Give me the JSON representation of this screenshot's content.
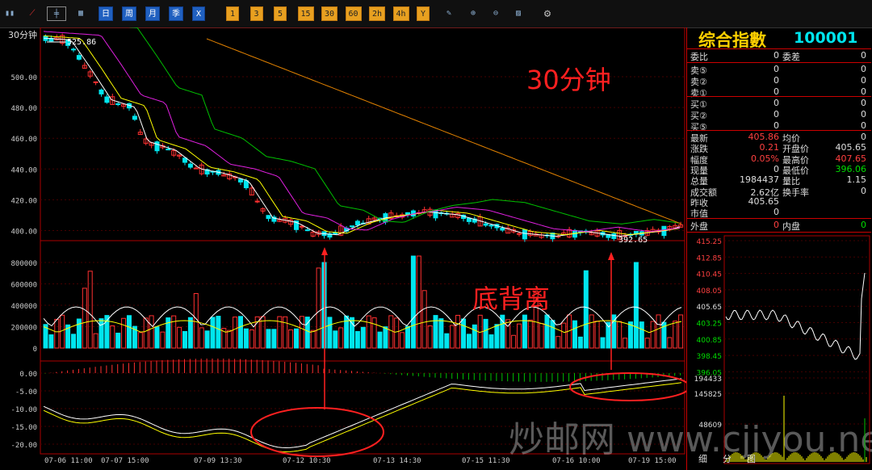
{
  "toolbar": {
    "period_buttons": [
      "日",
      "周",
      "月",
      "季",
      "X"
    ],
    "minute_buttons": [
      "1",
      "3",
      "5",
      "15",
      "30",
      "60",
      "2h",
      "4h",
      "Y"
    ]
  },
  "chart": {
    "period_label": "30分钟",
    "watermark_period": "30分钟",
    "annotation_divergence": "底背离",
    "high_label": "525.86",
    "low_label": "392.65",
    "price_ticks": [
      "500.00",
      "480.00",
      "460.00",
      "440.00",
      "420.00",
      "400.00"
    ],
    "volume_ticks": [
      "800000",
      "600000",
      "400000",
      "200000",
      "0"
    ],
    "macd_ticks": [
      "0.00",
      "-5.00",
      "-10.00",
      "-15.00",
      "-20.00"
    ],
    "x_labels": [
      "07-06 11:00",
      "07-07 15:00",
      "07-09 13:30",
      "07-12 10:30",
      "07-13 14:30",
      "07-15 11:30",
      "07-16 10:00",
      "07-19 15:00"
    ],
    "watermark": "炒邮网 www.cjiyou.net",
    "colors": {
      "up": "#ff3030",
      "down": "#00e5ee",
      "ma5": "#ffffff",
      "ma10": "#ffff00",
      "ma20": "#e020e0",
      "ma60": "#00c000",
      "ma120": "#e08000"
    }
  },
  "panel": {
    "title": "综合指數",
    "code": "100001",
    "weibi_label": "委比",
    "weibi_value": "0",
    "weicha_label": "委差",
    "weicha_value": "0",
    "sell": [
      {
        "label": "卖⑤",
        "price": "0",
        "vol": "0"
      },
      {
        "label": "卖②",
        "price": "0",
        "vol": "0"
      },
      {
        "label": "卖①",
        "price": "0",
        "vol": "0"
      }
    ],
    "buy": [
      {
        "label": "买①",
        "price": "0",
        "vol": "0"
      },
      {
        "label": "买②",
        "price": "0",
        "vol": "0"
      },
      {
        "label": "买⑤",
        "price": "0",
        "vol": "0"
      }
    ],
    "quotes": [
      {
        "l1": "最新",
        "v1": "405.86",
        "c1": "#ff4040",
        "l2": "均价",
        "v2": "0",
        "c2": "#ddd"
      },
      {
        "l1": "涨跌",
        "v1": "0.21",
        "c1": "#ff4040",
        "l2": "开盘价",
        "v2": "405.65",
        "c2": "#ddd"
      },
      {
        "l1": "幅度",
        "v1": "0.05%",
        "c1": "#ff4040",
        "l2": "最高价",
        "v2": "407.65",
        "c2": "#ff4040"
      },
      {
        "l1": "现量",
        "v1": "0",
        "c1": "#ddd",
        "l2": "最低价",
        "v2": "396.06",
        "c2": "#00dd00"
      },
      {
        "l1": "总量",
        "v1": "1984437",
        "c1": "#ddd",
        "l2": "量比",
        "v2": "1.15",
        "c2": "#ddd"
      },
      {
        "l1": "成交额",
        "v1": "2.62亿",
        "c1": "#ddd",
        "l2": "换手率",
        "v2": "0",
        "c2": "#ddd"
      },
      {
        "l1": "昨收",
        "v1": "405.65",
        "c1": "#ddd",
        "l2": "",
        "v2": "",
        "c2": "#ddd"
      },
      {
        "l1": "市值",
        "v1": "0",
        "c1": "#ddd",
        "l2": "",
        "v2": "",
        "c2": "#ddd"
      }
    ],
    "outer_label": "外盘",
    "outer_value": "0",
    "inner_label": "内盘",
    "inner_value": "0",
    "intraday_ticks": [
      "415.25",
      "412.85",
      "410.45",
      "408.05",
      "405.65",
      "403.25",
      "400.85",
      "398.45",
      "396.05"
    ],
    "intraday_vol_ticks": [
      "194433",
      "145825",
      "48609"
    ],
    "bottom_tabs": [
      "细",
      "分",
      "图"
    ]
  }
}
